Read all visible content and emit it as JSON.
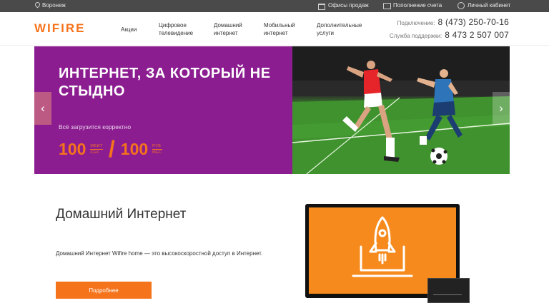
{
  "topbar": {
    "city": "Воронеж",
    "offices": "Офисы продаж",
    "topup": "Пополнение счета",
    "account": "Личный кабинет"
  },
  "header": {
    "logo": "WIFIRE",
    "nav": [
      "Акции",
      "Цифровое телевидение",
      "Домашний интернет",
      "Мобильный интернет",
      "Дополнительные услуги"
    ],
    "connect_label": "Подключение:",
    "connect_phone": "8 (473) 250-70-16",
    "support_label": "Служба поддержки:",
    "support_phone": "8 473 2 507 007"
  },
  "banner": {
    "headline": "ИНТЕРНЕТ, ЗА КОТОРЫЙ НЕ СТЫДНО",
    "subtitle": "Всё загрузится корректно",
    "speed_value": "100",
    "speed_unit_top": "МБИТ",
    "speed_unit_bottom": "СЕК",
    "price_value": "100",
    "price_unit_top": "РУБ",
    "price_unit_bottom": "МЕС",
    "arrow_left": "‹",
    "arrow_right": "›"
  },
  "content": {
    "title": "Домашний Интернет",
    "description": "Домашний Интернет Wifire home — это высокоскоростной доступ в Интернет.",
    "button": "Подробнее"
  },
  "colors": {
    "accent": "#f5731b",
    "banner_purple": "#8c1d91",
    "topbar": "#4a4a4a"
  }
}
